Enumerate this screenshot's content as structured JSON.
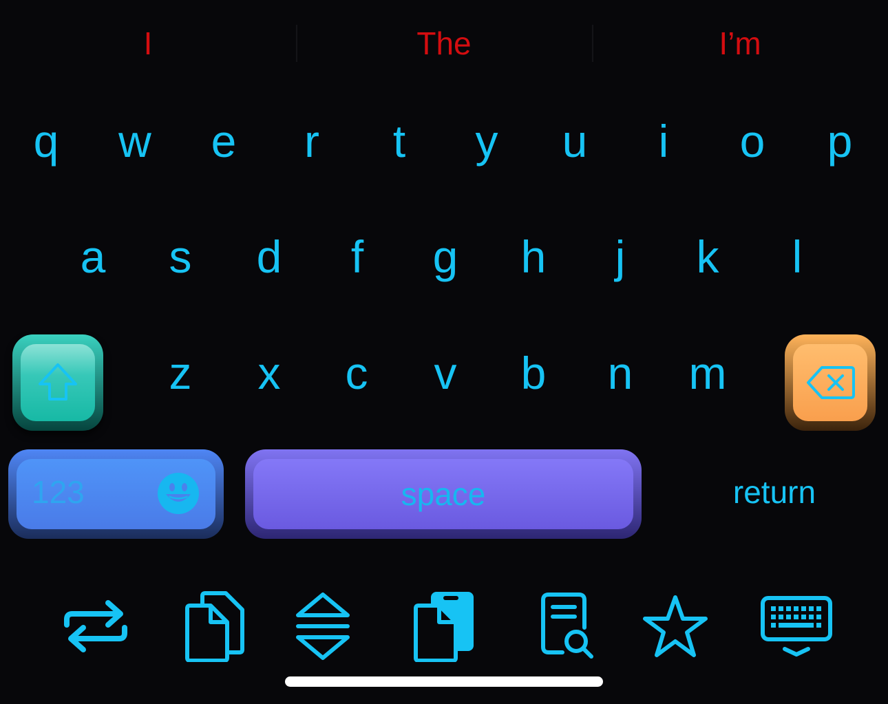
{
  "colors": {
    "background": "#07070a",
    "key_text": "#17c3f4",
    "suggestion_text": "#d40d10",
    "shift_key": "#37c8b8",
    "delete_key": "#f9a64f",
    "numbers_key": "#4c88f2",
    "space_key": "#7768ee"
  },
  "suggestions": [
    "I",
    "The",
    "I’m"
  ],
  "rows": {
    "row1": [
      "q",
      "w",
      "e",
      "r",
      "t",
      "y",
      "u",
      "i",
      "o",
      "p"
    ],
    "row2": [
      "a",
      "s",
      "d",
      "f",
      "g",
      "h",
      "j",
      "k",
      "l"
    ],
    "row3": [
      "z",
      "x",
      "c",
      "v",
      "b",
      "n",
      "m"
    ]
  },
  "keys": {
    "shift_icon": "shift-arrow-icon",
    "delete_icon": "delete-backward-icon",
    "numbers_label": "123",
    "emoji_icon": "smiley-face-icon",
    "space_label": "space",
    "return_label": "return"
  },
  "toolbar": {
    "items": [
      {
        "icon": "swap-arrows-icon"
      },
      {
        "icon": "copy-documents-icon"
      },
      {
        "icon": "expand-collapse-icon"
      },
      {
        "icon": "paste-phone-icon"
      },
      {
        "icon": "document-search-icon"
      },
      {
        "icon": "star-icon"
      },
      {
        "icon": "keyboard-hide-icon"
      }
    ]
  }
}
